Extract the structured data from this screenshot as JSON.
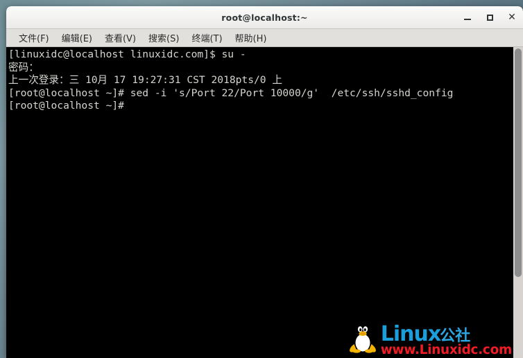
{
  "window": {
    "title": "root@localhost:~",
    "buttons": {
      "minimize": "minimize",
      "maximize": "maximize",
      "close": "✕"
    }
  },
  "menubar": {
    "items": [
      {
        "label": "文件(F)",
        "name": "menu-file"
      },
      {
        "label": "编辑(E)",
        "name": "menu-edit"
      },
      {
        "label": "查看(V)",
        "name": "menu-view"
      },
      {
        "label": "搜索(S)",
        "name": "menu-search"
      },
      {
        "label": "终端(T)",
        "name": "menu-terminal"
      },
      {
        "label": "帮助(H)",
        "name": "menu-help"
      }
    ]
  },
  "terminal": {
    "lines": [
      "[linuxidc@localhost linuxidc.com]$ su -",
      "密码：",
      "上一次登录：三 10月 17 19:27:31 CST 2018pts/0 上",
      "[root@localhost ~]# sed -i 's/Port 22/Port 10000/g'  /etc/ssh/sshd_config",
      "[root@localhost ~]# "
    ],
    "foreground": "#d3d7cf",
    "background": "#000000"
  },
  "watermark": {
    "brand": "Linux",
    "brand_suffix": "公社",
    "url": "www.Linuxidc.com",
    "brand_color": "#1b9fdc",
    "url_color": "#ef1c26"
  }
}
